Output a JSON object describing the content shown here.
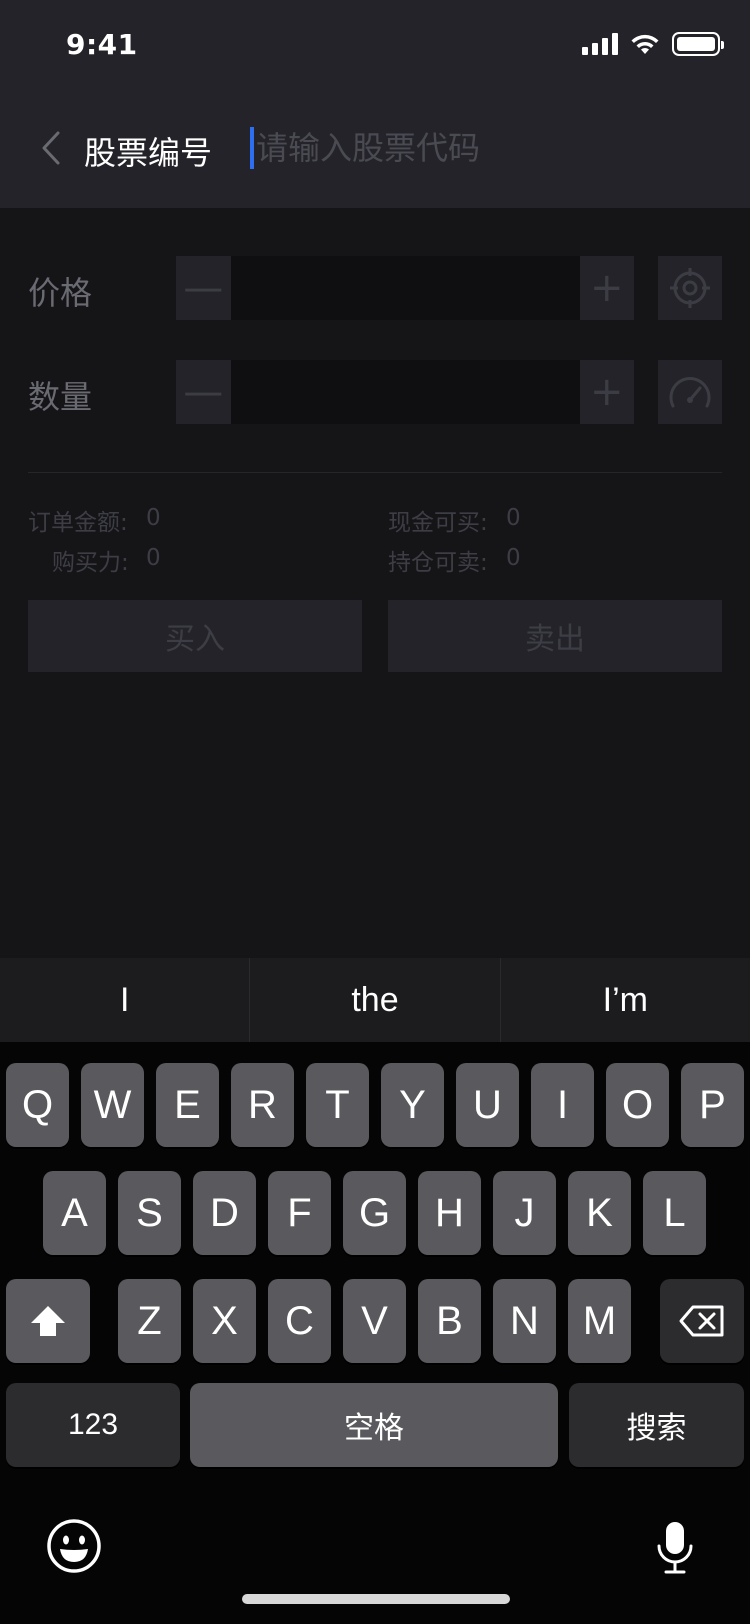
{
  "status_bar": {
    "time": "9:41"
  },
  "nav": {
    "title": "股票编号",
    "search_placeholder": "请输入股票代码",
    "search_value": ""
  },
  "form": {
    "price_label": "价格",
    "quantity_label": "数量",
    "minus_symbol": "—",
    "plus_symbol": "+",
    "price_value": "",
    "quantity_value": ""
  },
  "summary": {
    "order_amount_label": "订单金额:",
    "order_amount_value": "0",
    "buying_power_label": "购买力:",
    "buying_power_value": "0",
    "cash_buyable_label": "现金可买:",
    "cash_buyable_value": "0",
    "position_sellable_label": "持仓可卖:",
    "position_sellable_value": "0"
  },
  "actions": {
    "buy_label": "买入",
    "sell_label": "卖出"
  },
  "keyboard": {
    "suggestions": [
      "I",
      "the",
      "I’m"
    ],
    "row1": [
      "Q",
      "W",
      "E",
      "R",
      "T",
      "Y",
      "U",
      "I",
      "O",
      "P"
    ],
    "row2": [
      "A",
      "S",
      "D",
      "F",
      "G",
      "H",
      "J",
      "K",
      "L"
    ],
    "row3": [
      "Z",
      "X",
      "C",
      "V",
      "B",
      "N",
      "M"
    ],
    "numbers_label": "123",
    "space_label": "空格",
    "search_label": "搜索"
  },
  "colors": {
    "header_bg": "#232329",
    "page_bg": "#151518",
    "caret": "#2e6ff2",
    "key_bg": "#5a5a5e",
    "key_dark_bg": "#2c2c2e"
  }
}
